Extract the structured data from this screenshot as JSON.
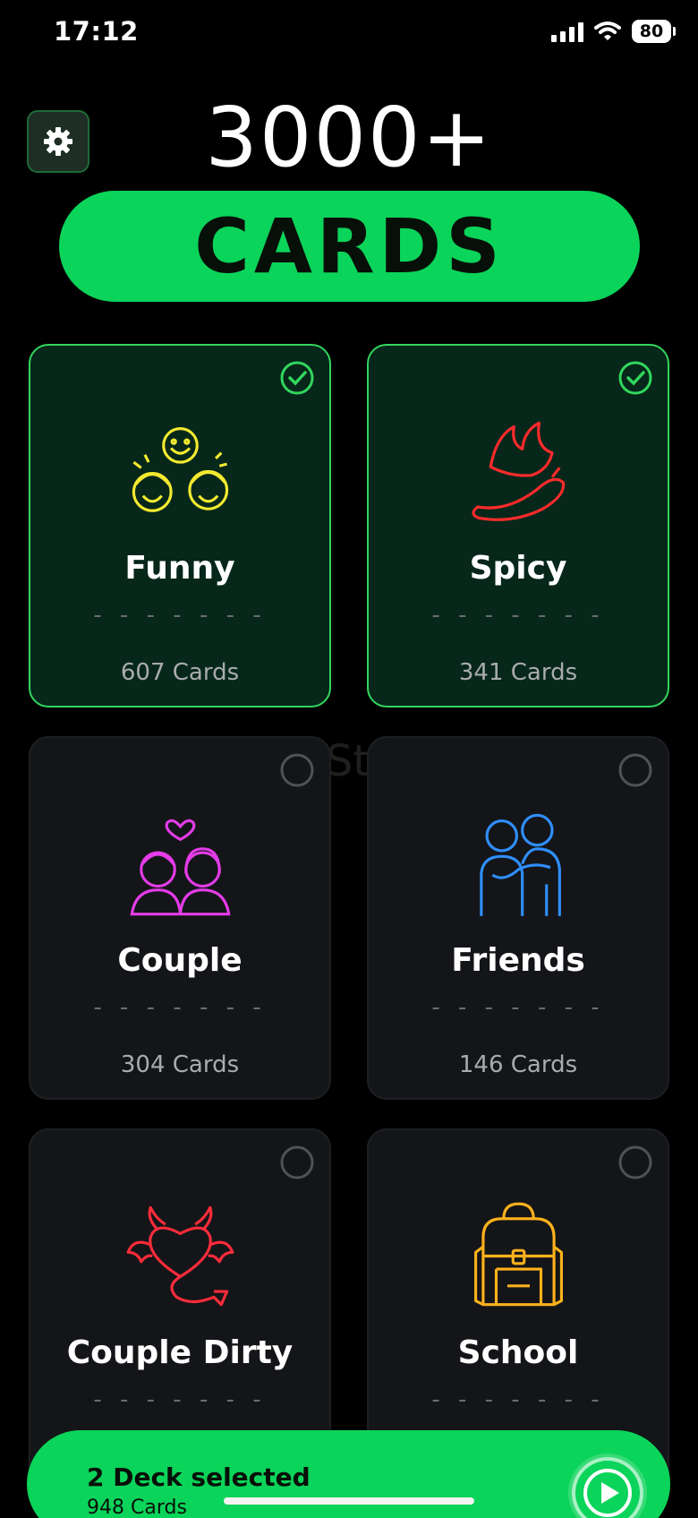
{
  "status_bar": {
    "time": "17:12",
    "battery": "80"
  },
  "header": {
    "settings_icon": "gear-icon",
    "count": "3000+",
    "label": "CARDS"
  },
  "colors": {
    "accent": "#0bd45a",
    "selected_card_bg": "#06271a",
    "selected_border": "#32d65d",
    "card_bg": "#141518"
  },
  "decks": [
    {
      "title": "Funny",
      "dashes": "- - - - - - -",
      "count": "607 Cards",
      "selected": true,
      "icon": "laughing-faces-icon"
    },
    {
      "title": "Spicy",
      "dashes": "- - - - - - -",
      "count": "341 Cards",
      "selected": true,
      "icon": "chili-pepper-icon"
    },
    {
      "title": "Couple",
      "dashes": "- - - - - - -",
      "count": "304 Cards",
      "selected": false,
      "icon": "couple-icon"
    },
    {
      "title": "Friends",
      "dashes": "- - - - - - -",
      "count": "146 Cards",
      "selected": false,
      "icon": "friends-icon"
    },
    {
      "title": "Couple Dirty",
      "dashes": "- - - - - - -",
      "count": "",
      "selected": false,
      "icon": "devil-heart-icon"
    },
    {
      "title": "School",
      "dashes": "- - - - - - -",
      "count": "",
      "selected": false,
      "icon": "backpack-icon"
    }
  ],
  "watermark": "UpdateStar.com",
  "bottom_bar": {
    "title": "2 Deck selected",
    "subtitle": "948 Cards"
  }
}
